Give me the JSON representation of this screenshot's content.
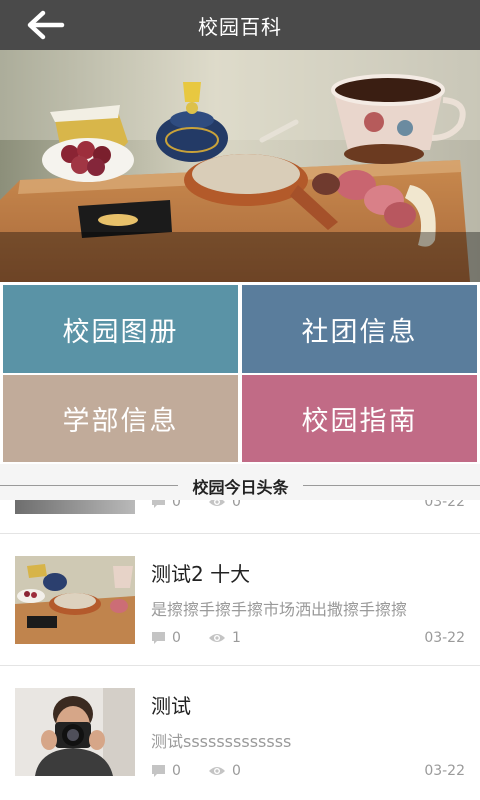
{
  "header": {
    "title": "校园百科",
    "back_icon": "arrow-left-icon"
  },
  "hero": {
    "image": "breakfast-table-photo"
  },
  "tiles": [
    {
      "label": "校园图册",
      "color": "#5a93a6"
    },
    {
      "label": "社团信息",
      "color": "#5a7d9c"
    },
    {
      "label": "学部信息",
      "color": "#c1ab9a"
    },
    {
      "label": "校园指南",
      "color": "#c16b86"
    }
  ],
  "section": {
    "title": "校园今日头条"
  },
  "news": [
    {
      "title": "",
      "summary": "",
      "comments": "0",
      "views": "0",
      "date": "03-22",
      "thumb": "partial-thumbnail"
    },
    {
      "title": "测试2 十大",
      "summary": "是擦擦手擦手擦市场洒出撒擦手擦擦",
      "comments": "0",
      "views": "1",
      "date": "03-22",
      "thumb": "breakfast-thumbnail"
    },
    {
      "title": "测试",
      "summary": "测试sssssssssssss",
      "comments": "0",
      "views": "0",
      "date": "03-22",
      "thumb": "photographer-thumbnail"
    }
  ]
}
